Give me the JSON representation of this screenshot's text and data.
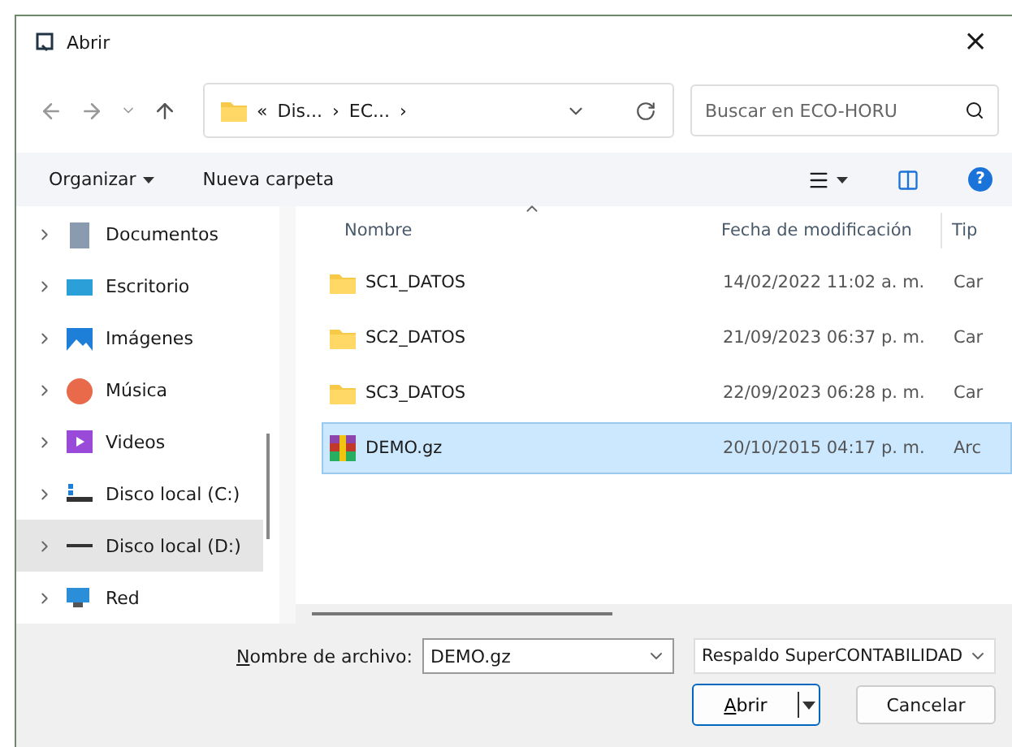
{
  "window": {
    "title": "Abrir",
    "close": "×"
  },
  "nav": {
    "breadcrumb": [
      {
        "text": "«"
      },
      {
        "text": "Dis..."
      },
      {
        "text": "›"
      },
      {
        "text": "EC..."
      },
      {
        "text": "›"
      }
    ],
    "search": {
      "placeholder": "Buscar en ECO-HORU"
    }
  },
  "toolbar": {
    "organize": "Organizar",
    "new_folder": "Nueva carpeta",
    "help": "?"
  },
  "sidebar": {
    "items": [
      {
        "label": "Documentos",
        "kind": "documents",
        "selected": false
      },
      {
        "label": "Escritorio",
        "kind": "desktop",
        "selected": false
      },
      {
        "label": "Imágenes",
        "kind": "pictures",
        "selected": false
      },
      {
        "label": "Música",
        "kind": "music",
        "selected": false
      },
      {
        "label": "Videos",
        "kind": "videos",
        "selected": false
      },
      {
        "label": "Disco local (C:)",
        "kind": "system-drive",
        "selected": false
      },
      {
        "label": "Disco local (D:)",
        "kind": "drive",
        "selected": true
      },
      {
        "label": "Red",
        "kind": "network",
        "selected": false
      }
    ]
  },
  "table": {
    "columns": [
      "Nombre",
      "Fecha de modificación",
      "Tip"
    ],
    "rows": [
      {
        "name": "SC1_DATOS",
        "date": "14/02/2022 11:02 a. m.",
        "type": "Car",
        "kind": "folder",
        "selected": false
      },
      {
        "name": "SC2_DATOS",
        "date": "21/09/2023 06:37 p. m.",
        "type": "Car",
        "kind": "folder",
        "selected": false
      },
      {
        "name": "SC3_DATOS",
        "date": "22/09/2023 06:28 p. m.",
        "type": "Car",
        "kind": "folder",
        "selected": false
      },
      {
        "name": "DEMO.gz",
        "date": "20/10/2015 04:17 p. m.",
        "type": "Arc",
        "kind": "archive",
        "selected": true
      }
    ]
  },
  "footer": {
    "filename_label": "Nombre de archivo:",
    "filename": "DEMO.gz",
    "filter": "Respaldo SuperCONTABILIDAD",
    "open": "Abrir",
    "cancel": "Cancelar"
  }
}
